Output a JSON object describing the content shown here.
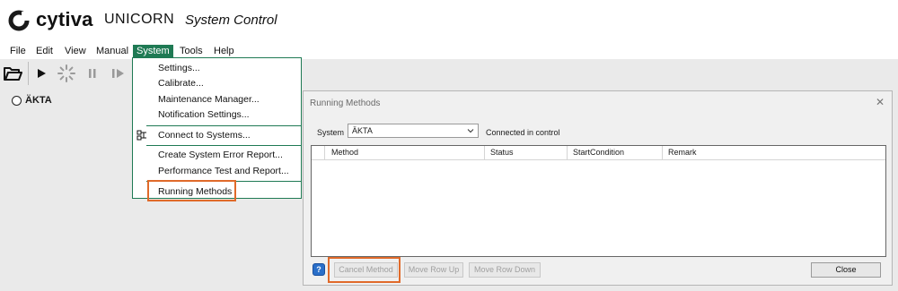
{
  "app": {
    "brand": "cytiva",
    "product": "UNICORN",
    "subtitle": "System Control",
    "brand_color": "#1f7a54",
    "icon": "cytiva-logo-icon"
  },
  "menubar": {
    "items": [
      "File",
      "Edit",
      "View",
      "Manual",
      "System",
      "Tools",
      "Help"
    ],
    "active": "System"
  },
  "toolbar": {
    "icons": [
      "open-folder-icon",
      "run-icon",
      "busy-spinner-icon",
      "pause-icon",
      "continue-icon"
    ]
  },
  "systems": {
    "items": [
      {
        "label": "ÄKTA",
        "icon": "radio-icon"
      }
    ]
  },
  "system_menu": {
    "items": [
      "Settings...",
      "Calibrate...",
      "Maintenance Manager...",
      "Notification Settings...",
      "Connect to Systems...",
      "Create System Error Report...",
      "Performance Test and Report...",
      "Running Methods"
    ],
    "highlighted": "Running Methods",
    "highlight_color": "#e06a2a"
  },
  "dialog": {
    "title": "Running Methods",
    "close_icon": "close-icon",
    "system_label": "System",
    "system_value": "ÄKTA",
    "connection_status": "Connected in control",
    "columns": [
      "Method",
      "Status",
      "StartCondition",
      "Remark"
    ],
    "rows": [],
    "buttons": {
      "help": "?",
      "cancel_method": "Cancel Method",
      "move_row_up": "Move Row Up",
      "move_row_down": "Move Row Down",
      "close": "Close"
    }
  }
}
